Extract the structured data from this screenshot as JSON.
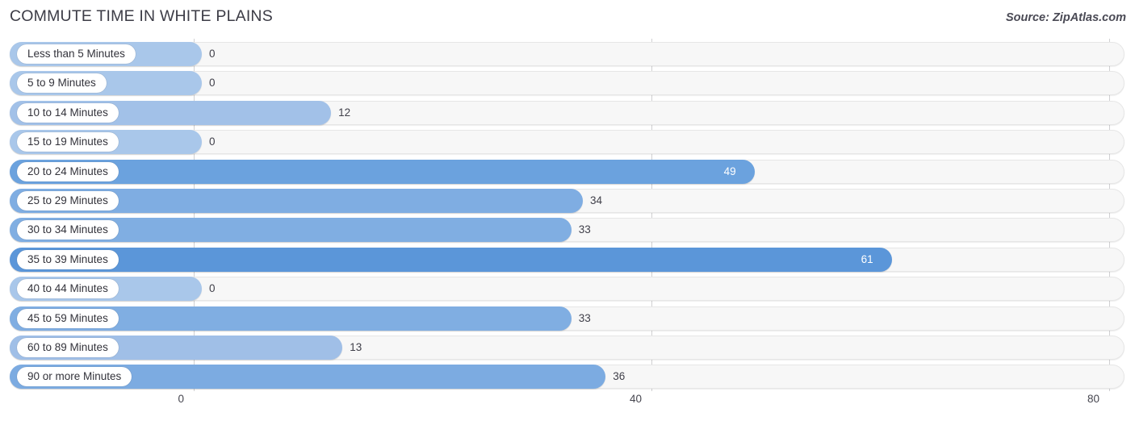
{
  "header": {
    "title": "COMMUTE TIME IN WHITE PLAINS",
    "source": "Source: ZipAtlas.com"
  },
  "chart_data": {
    "type": "bar",
    "orientation": "horizontal",
    "title": "COMMUTE TIME IN WHITE PLAINS",
    "xlabel": "",
    "ylabel": "",
    "xlim": [
      0,
      80
    ],
    "xticks": [
      0,
      40,
      80
    ],
    "xtick_labels": [
      "0",
      "40",
      "80"
    ],
    "grid": true,
    "legend": null,
    "categories": [
      "Less than 5 Minutes",
      "5 to 9 Minutes",
      "10 to 14 Minutes",
      "15 to 19 Minutes",
      "20 to 24 Minutes",
      "25 to 29 Minutes",
      "30 to 34 Minutes",
      "35 to 39 Minutes",
      "40 to 44 Minutes",
      "45 to 59 Minutes",
      "60 to 89 Minutes",
      "90 or more Minutes"
    ],
    "values": [
      0,
      0,
      12,
      0,
      49,
      34,
      33,
      61,
      0,
      33,
      13,
      36
    ],
    "value_labels": [
      "0",
      "0",
      "12",
      "0",
      "49",
      "34",
      "33",
      "61",
      "0",
      "33",
      "13",
      "36"
    ],
    "bar_colors": [
      "#a9c7ea",
      "#a9c7ea",
      "#a2c1e8",
      "#a9c7ea",
      "#6ba2de",
      "#7fade2",
      "#80aee2",
      "#5b96d9",
      "#a9c7ea",
      "#80aee2",
      "#a0bfe7",
      "#7cabe1"
    ],
    "label_inside": [
      false,
      false,
      false,
      false,
      true,
      false,
      false,
      true,
      false,
      false,
      false,
      false
    ],
    "track_color": "#f7f7f7",
    "gridline_color": "#d0d0d2"
  }
}
